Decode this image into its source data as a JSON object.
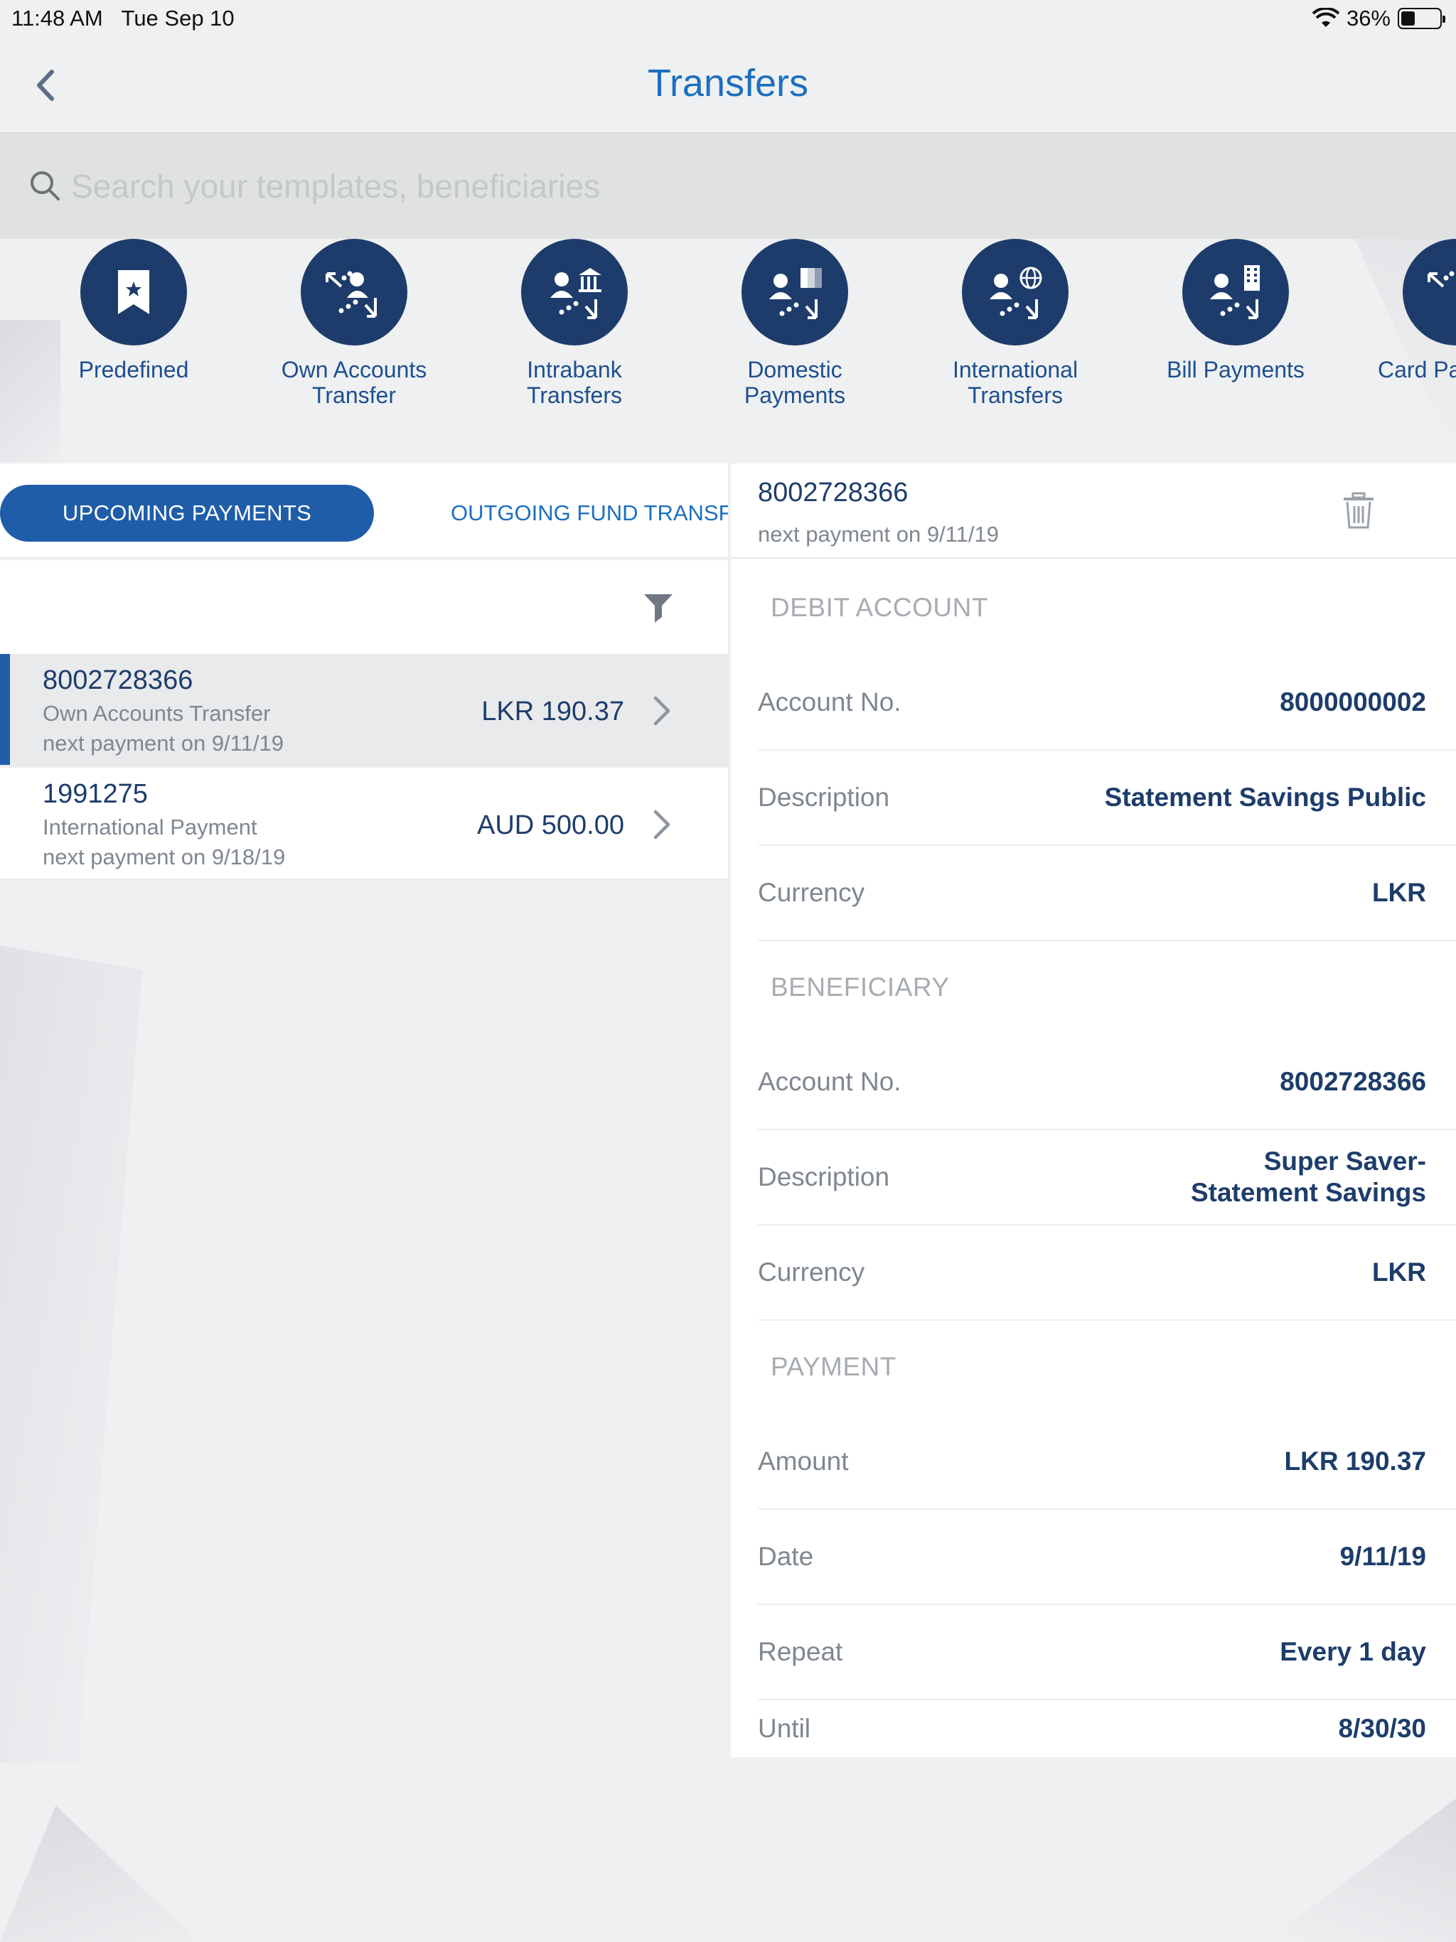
{
  "status_bar": {
    "time": "11:48 AM",
    "date": "Tue Sep 10",
    "battery": "36%",
    "battery_level": 0.36
  },
  "nav": {
    "title": "Transfers"
  },
  "search": {
    "placeholder": "Search your templates, beneficiaries"
  },
  "categories": [
    {
      "label_line1": "Predefined",
      "label_line2": "",
      "icon": "bookmark-star-icon"
    },
    {
      "label_line1": "Own Accounts",
      "label_line2": "Transfer",
      "icon": "own-accounts-transfer-icon"
    },
    {
      "label_line1": "Intrabank",
      "label_line2": "Transfers",
      "icon": "intrabank-transfer-icon"
    },
    {
      "label_line1": "Domestic",
      "label_line2": "Payments",
      "icon": "domestic-payment-icon"
    },
    {
      "label_line1": "International",
      "label_line2": "Transfers",
      "icon": "international-transfer-icon"
    },
    {
      "label_line1": "Bill Payments",
      "label_line2": "",
      "icon": "bill-payment-icon"
    },
    {
      "label_line1": "Card Pa",
      "label_line2": "",
      "icon": "card-payment-icon"
    }
  ],
  "tabs": {
    "active": "UPCOMING PAYMENTS",
    "inactive": "OUTGOING FUND TRANSF"
  },
  "payments": [
    {
      "id": "8002728366",
      "type": "Own Accounts Transfer",
      "next": "next payment on 9/11/19",
      "amount": "LKR 190.37",
      "selected": true
    },
    {
      "id": "1991275",
      "type": "International Payment",
      "next": "next payment on 9/18/19",
      "amount": "AUD 500.00",
      "selected": false
    }
  ],
  "detail": {
    "title": "8002728366",
    "subtitle": "next payment on 9/11/19",
    "debit_header": "DEBIT ACCOUNT",
    "debit": [
      {
        "label": "Account No.",
        "value": "8000000002"
      },
      {
        "label": "Description",
        "value": "Statement Savings Public"
      },
      {
        "label": "Currency",
        "value": "LKR"
      }
    ],
    "beneficiary_header": "BENEFICIARY",
    "beneficiary": [
      {
        "label": "Account No.",
        "value": "8002728366"
      },
      {
        "label": "Description",
        "value_line1": "Super Saver-",
        "value_line2": "Statement Savings"
      },
      {
        "label": "Currency",
        "value": "LKR"
      }
    ],
    "payment_header": "PAYMENT",
    "payment": [
      {
        "label": "Amount",
        "value": "LKR 190.37"
      },
      {
        "label": "Date",
        "value": "9/11/19"
      },
      {
        "label": "Repeat",
        "value": "Every 1 day"
      },
      {
        "label": "Until",
        "value": "8/30/30"
      }
    ]
  },
  "colors": {
    "accent": "#1f5da8",
    "title_blue": "#1d6fbf",
    "navy": "#1d3c6b",
    "muted": "#7f8790"
  }
}
